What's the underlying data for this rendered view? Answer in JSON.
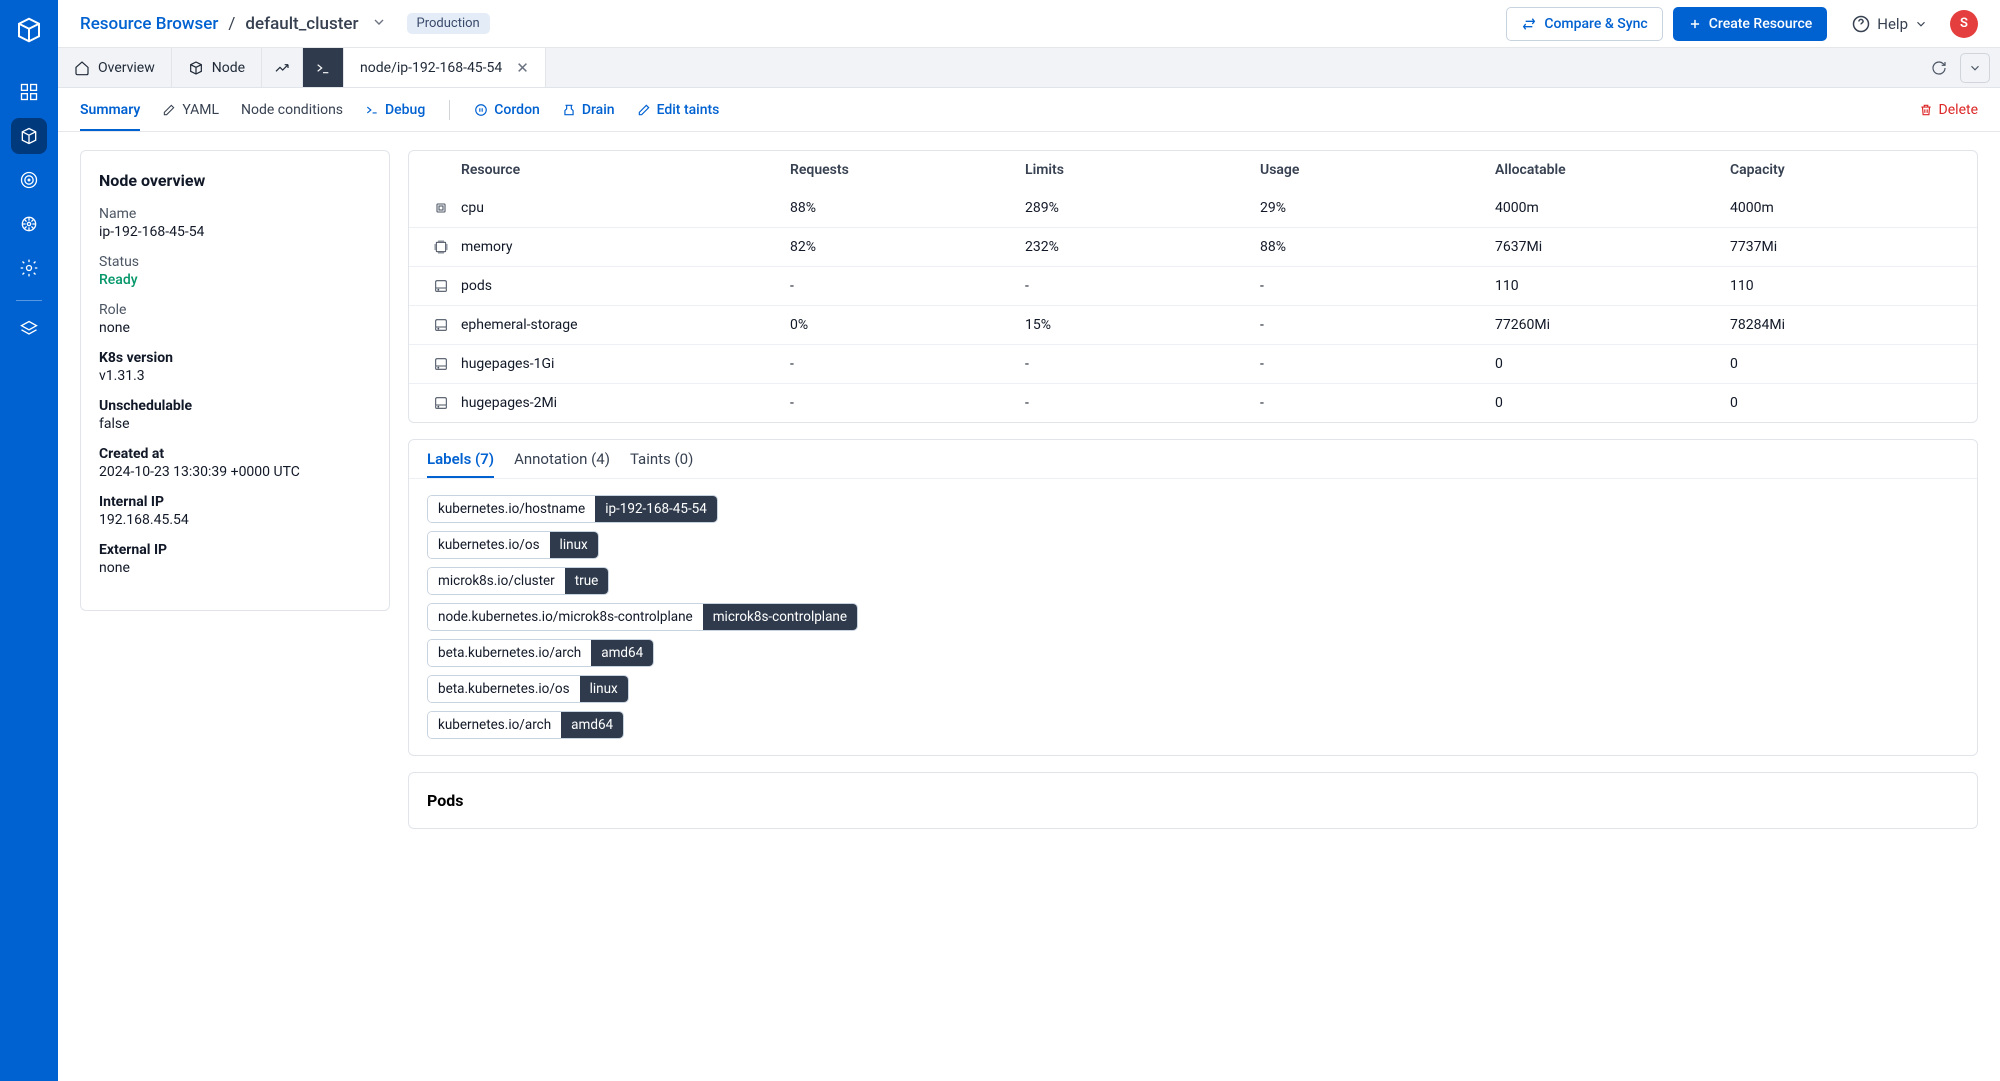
{
  "breadcrumb": {
    "root": "Resource Browser",
    "current": "default_cluster",
    "env": "Production"
  },
  "topbar": {
    "compare": "Compare & Sync",
    "create": "Create Resource",
    "help": "Help",
    "avatar": "S"
  },
  "tabs": {
    "overview": "Overview",
    "node": "Node",
    "file": "node/ip-192-168-45-54"
  },
  "subtabs": {
    "summary": "Summary",
    "yaml": "YAML",
    "conditions": "Node conditions",
    "debug": "Debug",
    "cordon": "Cordon",
    "drain": "Drain",
    "taints": "Edit taints",
    "delete": "Delete"
  },
  "overview": {
    "title": "Node overview",
    "fields": {
      "name_l": "Name",
      "name_v": "ip-192-168-45-54",
      "status_l": "Status",
      "status_v": "Ready",
      "role_l": "Role",
      "role_v": "none",
      "k8s_l": "K8s version",
      "k8s_v": "v1.31.3",
      "unsched_l": "Unschedulable",
      "unsched_v": "false",
      "created_l": "Created at",
      "created_v": "2024-10-23 13:30:39 +0000 UTC",
      "intip_l": "Internal IP",
      "intip_v": "192.168.45.54",
      "extip_l": "External IP",
      "extip_v": "none"
    }
  },
  "resources": {
    "headers": {
      "resource": "Resource",
      "requests": "Requests",
      "limits": "Limits",
      "usage": "Usage",
      "alloc": "Allocatable",
      "cap": "Capacity"
    },
    "rows": [
      {
        "name": "cpu",
        "requests": "88%",
        "limits": "289%",
        "usage": "29%",
        "alloc": "4000m",
        "cap": "4000m",
        "icon": "cpu"
      },
      {
        "name": "memory",
        "requests": "82%",
        "limits": "232%",
        "usage": "88%",
        "alloc": "7637Mi",
        "cap": "7737Mi",
        "icon": "memory"
      },
      {
        "name": "pods",
        "requests": "-",
        "limits": "-",
        "usage": "-",
        "alloc": "110",
        "cap": "110",
        "icon": "disk"
      },
      {
        "name": "ephemeral-storage",
        "requests": "0%",
        "limits": "15%",
        "usage": "-",
        "alloc": "77260Mi",
        "cap": "78284Mi",
        "icon": "disk"
      },
      {
        "name": "hugepages-1Gi",
        "requests": "-",
        "limits": "-",
        "usage": "-",
        "alloc": "0",
        "cap": "0",
        "icon": "disk"
      },
      {
        "name": "hugepages-2Mi",
        "requests": "-",
        "limits": "-",
        "usage": "-",
        "alloc": "0",
        "cap": "0",
        "icon": "disk"
      }
    ]
  },
  "labelTabs": {
    "labels": "Labels (7)",
    "annotation": "Annotation (4)",
    "taints": "Taints (0)"
  },
  "labels": [
    {
      "k": "kubernetes.io/hostname",
      "v": "ip-192-168-45-54"
    },
    {
      "k": "kubernetes.io/os",
      "v": "linux"
    },
    {
      "k": "microk8s.io/cluster",
      "v": "true"
    },
    {
      "k": "node.kubernetes.io/microk8s-controlplane",
      "v": "microk8s-controlplane"
    },
    {
      "k": "beta.kubernetes.io/arch",
      "v": "amd64"
    },
    {
      "k": "beta.kubernetes.io/os",
      "v": "linux"
    },
    {
      "k": "kubernetes.io/arch",
      "v": "amd64"
    }
  ],
  "pods": {
    "title": "Pods"
  }
}
